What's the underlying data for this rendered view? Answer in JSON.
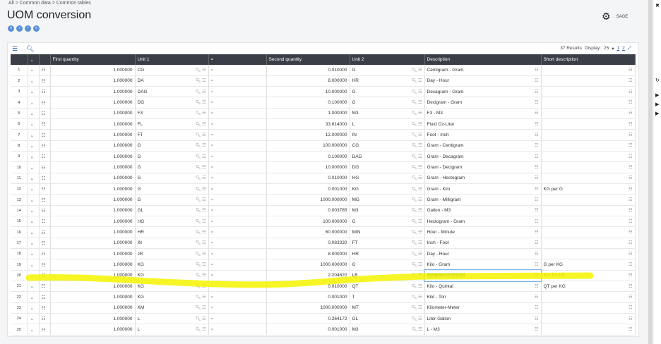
{
  "breadcrumb": [
    "All",
    "Common data",
    "Common tables"
  ],
  "title": "UOM conversion",
  "user": "SAGE",
  "toolbar": {
    "results": "37 Results",
    "display_label": "Display:",
    "display_value": "25",
    "pages": [
      "1",
      "2"
    ]
  },
  "columns": [
    "",
    "",
    "",
    "First quantity",
    "Unit 1",
    "=",
    "Second quantity",
    "Unit 2",
    "Description",
    "Short description"
  ],
  "rows": [
    [
      "1",
      "1.000000",
      "CG",
      "0.010000",
      "G",
      "Centigram - Gram",
      ""
    ],
    [
      "2",
      "1.000000",
      "DA",
      "8.000000",
      "HR",
      "Day - Hour",
      ""
    ],
    [
      "3",
      "1.000000",
      "DAG",
      "10.000000",
      "G",
      "Decagram - Gram",
      ""
    ],
    [
      "4",
      "1.000000",
      "DG",
      "0.100000",
      "G",
      "Decigram - Gram",
      ""
    ],
    [
      "5",
      "1.000000",
      "F3",
      "1.000000",
      "M3",
      "F3 - M3",
      ""
    ],
    [
      "6",
      "1.000000",
      "FL",
      "33.814000",
      "L",
      "Fluid Oz-Liter",
      ""
    ],
    [
      "7",
      "1.000000",
      "FT",
      "12.000000",
      "IN",
      "Foot - Inch",
      ""
    ],
    [
      "8",
      "1.000000",
      "G",
      "100.000000",
      "CG",
      "Gram - Centigram",
      ""
    ],
    [
      "9",
      "1.000000",
      "G",
      "0.100000",
      "DAG",
      "Gram - Decagram",
      ""
    ],
    [
      "10",
      "1.000000",
      "G",
      "10.000000",
      "DG",
      "Gram - Decigram",
      ""
    ],
    [
      "11",
      "1.000000",
      "G",
      "0.010000",
      "HG",
      "Gram - Hectogram",
      ""
    ],
    [
      "12",
      "1.000000",
      "G",
      "0.001000",
      "KG",
      "Gram - Kilo",
      "KG per G"
    ],
    [
      "13",
      "1.000000",
      "G",
      "1000.000000",
      "MG",
      "Gram - Milligram",
      ""
    ],
    [
      "14",
      "1.000000",
      "GL",
      "0.003785",
      "M3",
      "Gallon - M3",
      ""
    ],
    [
      "15",
      "1.000000",
      "HG",
      "100.000000",
      "G",
      "Hectogram - Gram",
      ""
    ],
    [
      "16",
      "1.000000",
      "HR",
      "60.000000",
      "MIN",
      "Hour - Minute",
      ""
    ],
    [
      "17",
      "1.000000",
      "IN",
      "0.083330",
      "FT",
      "Inch - Foot",
      ""
    ],
    [
      "18",
      "1.000000",
      "JR",
      "8.000000",
      "HR",
      "Day - Hour",
      ""
    ],
    [
      "19",
      "1.000000",
      "KG",
      "1000.000000",
      "G",
      "Kilo - Gram",
      "G per KG"
    ],
    [
      "20",
      "1.000000",
      "KG",
      "2.204620",
      "LB",
      "Kilogram to Pound",
      "KG TO LB"
    ],
    [
      "21",
      "1.000000",
      "KG",
      "0.010000",
      "QT",
      "Kilo - Quintal",
      "QT per KG"
    ],
    [
      "22",
      "1.000000",
      "KG",
      "0.001000",
      "T",
      "Kilo - Ton",
      ""
    ],
    [
      "23",
      "1.000000",
      "KM",
      "1000.000000",
      "MT",
      "Kilometer-Meter",
      ""
    ],
    [
      "24",
      "1.000000",
      "L",
      "0.264172",
      "GL",
      "Liter-Gallon",
      ""
    ],
    [
      "25",
      "1.000000",
      "L",
      "0.001000",
      "M3",
      "L - M3",
      ""
    ]
  ],
  "selected_row": "20",
  "colors": {
    "header": "#3a3f47",
    "accent": "#2a5ca8",
    "highlighter": "#f5f500"
  }
}
